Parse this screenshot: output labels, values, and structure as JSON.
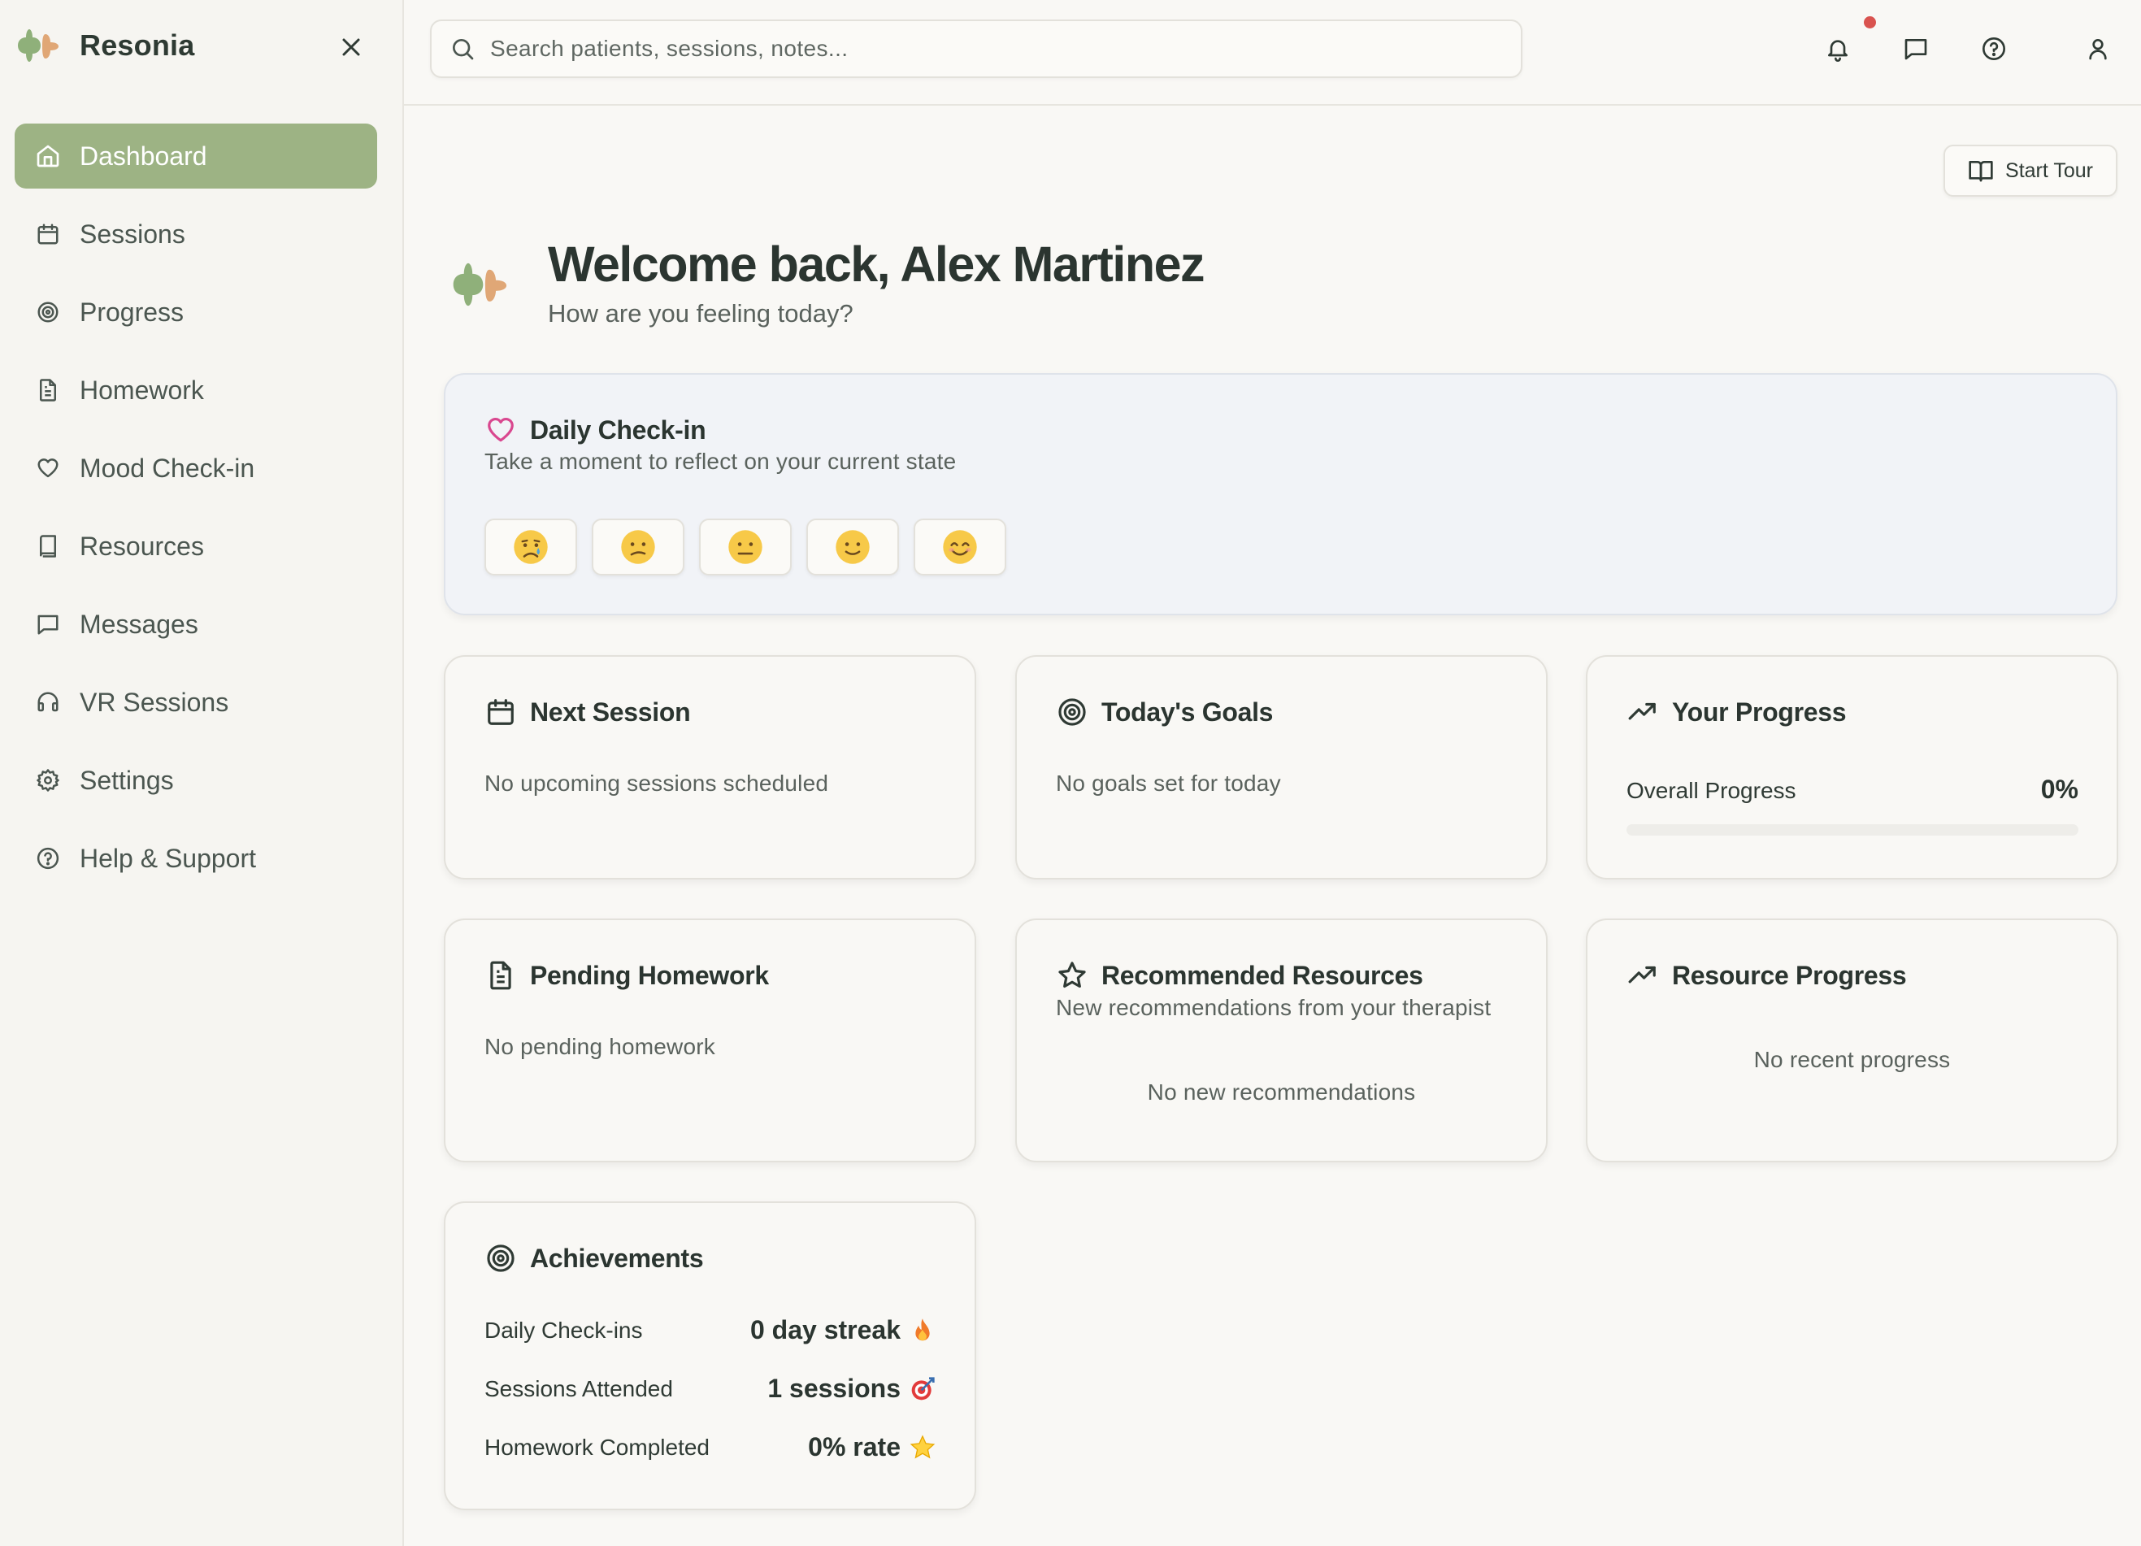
{
  "app": {
    "name": "Resonia"
  },
  "colors": {
    "accent": "#9db384",
    "logo_green": "#8fb07a",
    "logo_orange": "#e0a776",
    "heart": "#d9478f",
    "notification": "#d9534f"
  },
  "sidebar": {
    "items": [
      {
        "label": "Dashboard",
        "icon": "home-icon",
        "active": true
      },
      {
        "label": "Sessions",
        "icon": "calendar-icon"
      },
      {
        "label": "Progress",
        "icon": "target-icon"
      },
      {
        "label": "Homework",
        "icon": "document-icon"
      },
      {
        "label": "Mood Check-in",
        "icon": "heart-icon"
      },
      {
        "label": "Resources",
        "icon": "book-icon"
      },
      {
        "label": "Messages",
        "icon": "message-icon"
      },
      {
        "label": "VR Sessions",
        "icon": "headphones-icon"
      },
      {
        "label": "Settings",
        "icon": "gear-icon"
      },
      {
        "label": "Help & Support",
        "icon": "help-icon"
      }
    ]
  },
  "search": {
    "placeholder": "Search patients, sessions, notes..."
  },
  "main": {
    "tour_label": "Start Tour",
    "welcome_title": "Welcome back, Alex Martinez",
    "welcome_subtitle": "How are you feeling today?"
  },
  "checkin": {
    "title": "Daily Check-in",
    "subtitle": "Take a moment to reflect on your current state",
    "moods": [
      "crying-face",
      "confused-face",
      "neutral-face",
      "slightly-smiling-face",
      "smiling-face"
    ]
  },
  "next_session": {
    "title": "Next Session",
    "text": "No upcoming sessions scheduled"
  },
  "todays_goals": {
    "title": "Today's Goals",
    "text": "No goals set for today"
  },
  "your_progress": {
    "title": "Your Progress",
    "label": "Overall Progress",
    "value": "0%",
    "fraction": 0
  },
  "pending_homework": {
    "title": "Pending Homework",
    "text": "No pending homework"
  },
  "recommended": {
    "title": "Recommended Resources",
    "subtitle": "New recommendations from your therapist",
    "text": "No new recommendations"
  },
  "resource_progress": {
    "title": "Resource Progress",
    "text": "No recent progress"
  },
  "achievements": {
    "title": "Achievements",
    "rows": [
      {
        "label": "Daily Check-ins",
        "value": "0 day streak",
        "icon": "fire-icon"
      },
      {
        "label": "Sessions Attended",
        "value": "1 sessions",
        "icon": "bullseye-icon"
      },
      {
        "label": "Homework Completed",
        "value": "0% rate",
        "icon": "star-icon"
      }
    ]
  }
}
